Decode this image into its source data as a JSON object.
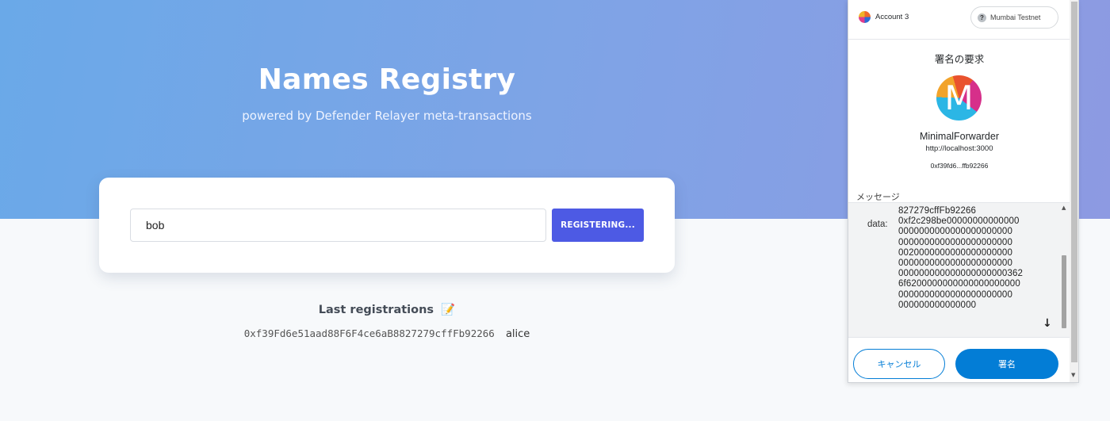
{
  "page": {
    "title": "Names Registry",
    "subtitle": "powered by Defender Relayer meta-transactions"
  },
  "register_form": {
    "name_value": "bob",
    "button_label": "REGISTERING..."
  },
  "registrations": {
    "heading": "Last registrations",
    "heading_emoji": "📝",
    "items": [
      {
        "address": "0xf39Fd6e51aad88F6F4ce6aB8827279cffFb92266",
        "name": "alice"
      }
    ]
  },
  "wallet": {
    "account": "Account 3",
    "network": "Mumbai Testnet",
    "network_icon": "?",
    "title": "署名の要求",
    "app_logo_letter": "M",
    "app_name": "MinimalForwarder",
    "app_origin": "http://localhost:3000",
    "contract_short": "0xf39fd6...ffb92266",
    "message_label": "メッセージ",
    "data_key": "data:",
    "message_lines": [
      "827279cffFb92266",
      "0xf2c298be00000000000000",
      "0000000000000000000000",
      "0000000000000000000000",
      "0020000000000000000000",
      "0000000000000000000000",
      "000000000000000000000362",
      "6f6200000000000000000000",
      "0000000000000000000000",
      "000000000000000"
    ],
    "cancel_label": "キャンセル",
    "sign_label": "署名"
  }
}
